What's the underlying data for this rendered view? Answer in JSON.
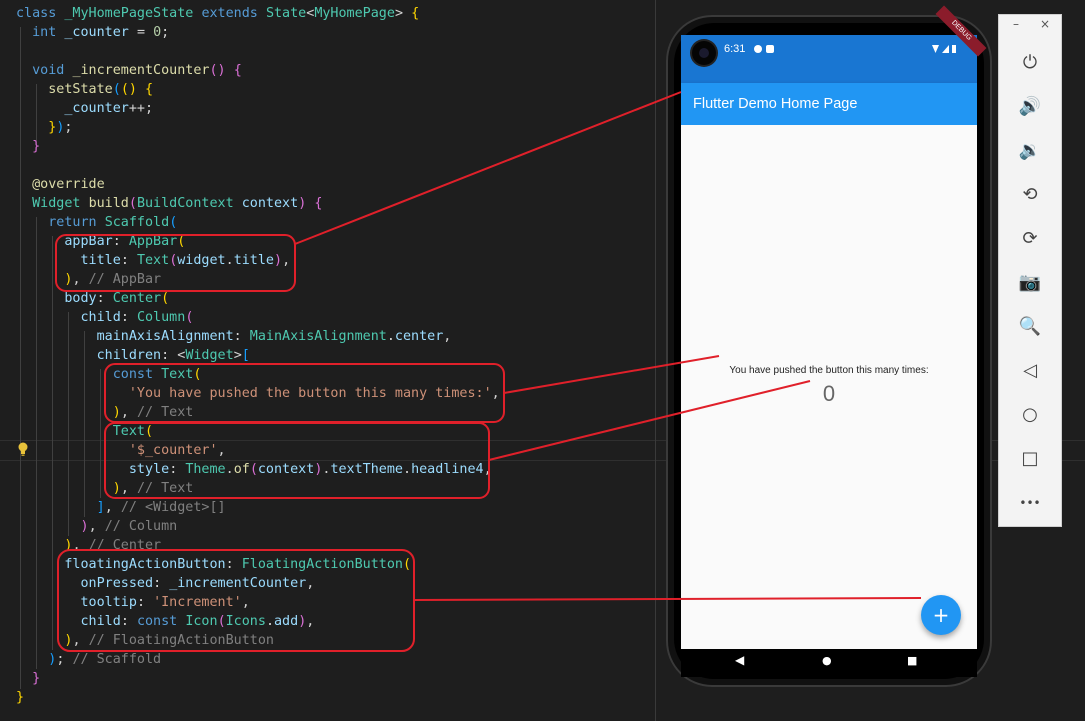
{
  "code": {
    "lines": [
      [
        {
          "t": "class ",
          "c": "kw"
        },
        {
          "t": "_MyHomePageState ",
          "c": "cls"
        },
        {
          "t": "extends ",
          "c": "kw"
        },
        {
          "t": "State",
          "c": "cls"
        },
        {
          "t": "<",
          "c": "plain"
        },
        {
          "t": "MyHomePage",
          "c": "cls"
        },
        {
          "t": "> ",
          "c": "plain"
        },
        {
          "t": "{",
          "c": "pn1"
        }
      ],
      [
        {
          "t": "  int ",
          "c": "kw"
        },
        {
          "t": "_counter ",
          "c": "var"
        },
        {
          "t": "= ",
          "c": "plain"
        },
        {
          "t": "0",
          "c": "num"
        },
        {
          "t": ";",
          "c": "plain"
        }
      ],
      [],
      [
        {
          "t": "  void ",
          "c": "kw"
        },
        {
          "t": "_incrementCounter",
          "c": "fn"
        },
        {
          "t": "() ",
          "c": "pn2"
        },
        {
          "t": "{",
          "c": "pn2"
        }
      ],
      [
        {
          "t": "    setState",
          "c": "fn"
        },
        {
          "t": "(",
          "c": "pn3"
        },
        {
          "t": "() ",
          "c": "pn1"
        },
        {
          "t": "{",
          "c": "pn1"
        }
      ],
      [
        {
          "t": "      _counter",
          "c": "var"
        },
        {
          "t": "++;",
          "c": "plain"
        }
      ],
      [
        {
          "t": "    }",
          "c": "pn1"
        },
        {
          "t": ")",
          "c": "pn3"
        },
        {
          "t": ";",
          "c": "plain"
        }
      ],
      [
        {
          "t": "  }",
          "c": "pn2"
        }
      ],
      [],
      [
        {
          "t": "  @override",
          "c": "fn"
        }
      ],
      [
        {
          "t": "  Widget ",
          "c": "cls"
        },
        {
          "t": "build",
          "c": "fn"
        },
        {
          "t": "(",
          "c": "pn2"
        },
        {
          "t": "BuildContext ",
          "c": "cls"
        },
        {
          "t": "context",
          "c": "var"
        },
        {
          "t": ") ",
          "c": "pn2"
        },
        {
          "t": "{",
          "c": "pn2"
        }
      ],
      [
        {
          "t": "    return ",
          "c": "kw"
        },
        {
          "t": "Scaffold",
          "c": "cls"
        },
        {
          "t": "(",
          "c": "pn3"
        }
      ],
      [
        {
          "t": "      appBar",
          "c": "var"
        },
        {
          "t": ": ",
          "c": "plain"
        },
        {
          "t": "AppBar",
          "c": "cls"
        },
        {
          "t": "(",
          "c": "pn1"
        }
      ],
      [
        {
          "t": "        title",
          "c": "var"
        },
        {
          "t": ": ",
          "c": "plain"
        },
        {
          "t": "Text",
          "c": "cls"
        },
        {
          "t": "(",
          "c": "pn2"
        },
        {
          "t": "widget",
          "c": "var"
        },
        {
          "t": ".",
          "c": "plain"
        },
        {
          "t": "title",
          "c": "var"
        },
        {
          "t": ")",
          "c": "pn2"
        },
        {
          "t": ",",
          "c": "plain"
        }
      ],
      [
        {
          "t": "      )",
          "c": "pn1"
        },
        {
          "t": ", ",
          "c": "plain"
        },
        {
          "t": "// AppBar",
          "c": "cm2"
        }
      ],
      [
        {
          "t": "      body",
          "c": "var"
        },
        {
          "t": ": ",
          "c": "plain"
        },
        {
          "t": "Center",
          "c": "cls"
        },
        {
          "t": "(",
          "c": "pn1"
        }
      ],
      [
        {
          "t": "        child",
          "c": "var"
        },
        {
          "t": ": ",
          "c": "plain"
        },
        {
          "t": "Column",
          "c": "cls"
        },
        {
          "t": "(",
          "c": "pn2"
        }
      ],
      [
        {
          "t": "          mainAxisAlignment",
          "c": "var"
        },
        {
          "t": ": ",
          "c": "plain"
        },
        {
          "t": "MainAxisAlignment",
          "c": "cls"
        },
        {
          "t": ".",
          "c": "plain"
        },
        {
          "t": "center",
          "c": "var"
        },
        {
          "t": ",",
          "c": "plain"
        }
      ],
      [
        {
          "t": "          children",
          "c": "var"
        },
        {
          "t": ": ",
          "c": "plain"
        },
        {
          "t": "<",
          "c": "plain"
        },
        {
          "t": "Widget",
          "c": "cls"
        },
        {
          "t": ">",
          "c": "plain"
        },
        {
          "t": "[",
          "c": "pn3"
        }
      ],
      [
        {
          "t": "            const ",
          "c": "kw"
        },
        {
          "t": "Text",
          "c": "cls"
        },
        {
          "t": "(",
          "c": "pn1"
        }
      ],
      [
        {
          "t": "              'You have pushed the button this many times:'",
          "c": "str"
        },
        {
          "t": ",",
          "c": "plain"
        }
      ],
      [
        {
          "t": "            )",
          "c": "pn1"
        },
        {
          "t": ", ",
          "c": "plain"
        },
        {
          "t": "// Text",
          "c": "cm2"
        }
      ],
      [
        {
          "t": "            Text",
          "c": "cls"
        },
        {
          "t": "(",
          "c": "pn1"
        }
      ],
      [
        {
          "t": "              '$_counter'",
          "c": "str"
        },
        {
          "t": ",",
          "c": "plain"
        }
      ],
      [
        {
          "t": "              style",
          "c": "var"
        },
        {
          "t": ": ",
          "c": "plain"
        },
        {
          "t": "Theme",
          "c": "cls"
        },
        {
          "t": ".",
          "c": "plain"
        },
        {
          "t": "of",
          "c": "fn"
        },
        {
          "t": "(",
          "c": "pn2"
        },
        {
          "t": "context",
          "c": "var"
        },
        {
          "t": ")",
          "c": "pn2"
        },
        {
          "t": ".",
          "c": "plain"
        },
        {
          "t": "textTheme",
          "c": "var"
        },
        {
          "t": ".",
          "c": "plain"
        },
        {
          "t": "headline4",
          "c": "var"
        },
        {
          "t": ",",
          "c": "plain"
        }
      ],
      [
        {
          "t": "            )",
          "c": "pn1"
        },
        {
          "t": ", ",
          "c": "plain"
        },
        {
          "t": "// Text",
          "c": "cm2"
        }
      ],
      [
        {
          "t": "          ]",
          "c": "pn3"
        },
        {
          "t": ", ",
          "c": "plain"
        },
        {
          "t": "// <Widget>[]",
          "c": "cm2"
        }
      ],
      [
        {
          "t": "        )",
          "c": "pn2"
        },
        {
          "t": ", ",
          "c": "plain"
        },
        {
          "t": "// Column",
          "c": "cm2"
        }
      ],
      [
        {
          "t": "      )",
          "c": "pn1"
        },
        {
          "t": ", ",
          "c": "plain"
        },
        {
          "t": "// Center",
          "c": "cm2"
        }
      ],
      [
        {
          "t": "      floatingActionButton",
          "c": "var"
        },
        {
          "t": ": ",
          "c": "plain"
        },
        {
          "t": "FloatingActionButton",
          "c": "cls"
        },
        {
          "t": "(",
          "c": "pn1"
        }
      ],
      [
        {
          "t": "        onPressed",
          "c": "var"
        },
        {
          "t": ": ",
          "c": "plain"
        },
        {
          "t": "_incrementCounter",
          "c": "var"
        },
        {
          "t": ",",
          "c": "plain"
        }
      ],
      [
        {
          "t": "        tooltip",
          "c": "var"
        },
        {
          "t": ": ",
          "c": "plain"
        },
        {
          "t": "'Increment'",
          "c": "str"
        },
        {
          "t": ",",
          "c": "plain"
        }
      ],
      [
        {
          "t": "        child",
          "c": "var"
        },
        {
          "t": ": ",
          "c": "plain"
        },
        {
          "t": "const ",
          "c": "kw"
        },
        {
          "t": "Icon",
          "c": "cls"
        },
        {
          "t": "(",
          "c": "pn2"
        },
        {
          "t": "Icons",
          "c": "cls"
        },
        {
          "t": ".",
          "c": "plain"
        },
        {
          "t": "add",
          "c": "var"
        },
        {
          "t": ")",
          "c": "pn2"
        },
        {
          "t": ",",
          "c": "plain"
        }
      ],
      [
        {
          "t": "      )",
          "c": "pn1"
        },
        {
          "t": ", ",
          "c": "plain"
        },
        {
          "t": "// FloatingActionButton",
          "c": "cm2"
        }
      ],
      [
        {
          "t": "    )",
          "c": "pn3"
        },
        {
          "t": "; ",
          "c": "plain"
        },
        {
          "t": "// Scaffold",
          "c": "cm2"
        }
      ],
      [
        {
          "t": "  }",
          "c": "pn2"
        }
      ],
      [
        {
          "t": "}",
          "c": "pn1"
        }
      ]
    ]
  },
  "phone": {
    "time": "6:31",
    "debug_banner": "DEBUG",
    "app_title": "Flutter Demo Home Page",
    "pushed_text": "You have pushed the button this many times:",
    "counter": "0",
    "fab_icon": "add-icon",
    "fab_label": "+",
    "nav": {
      "back": "◀",
      "home": "●",
      "recents": "■"
    }
  },
  "toolbar": {
    "minimize": "–",
    "close": "×",
    "buttons": [
      {
        "name": "power-icon",
        "glyph": "⏻"
      },
      {
        "name": "volume-up-icon",
        "glyph": "🔊"
      },
      {
        "name": "volume-down-icon",
        "glyph": "🔉"
      },
      {
        "name": "rotate-left-icon",
        "glyph": "⟲"
      },
      {
        "name": "rotate-right-icon",
        "glyph": "⟳"
      },
      {
        "name": "camera-icon",
        "glyph": "📷"
      },
      {
        "name": "zoom-icon",
        "glyph": "🔍"
      },
      {
        "name": "back-icon",
        "glyph": "◁"
      },
      {
        "name": "home-icon",
        "glyph": "○"
      },
      {
        "name": "overview-icon",
        "glyph": "□"
      },
      {
        "name": "more-icon",
        "glyph": "•••"
      }
    ]
  },
  "colors": {
    "appbar": "#2196f3",
    "annotation": "#e0202a",
    "editor_bg": "#1e1e1e"
  }
}
